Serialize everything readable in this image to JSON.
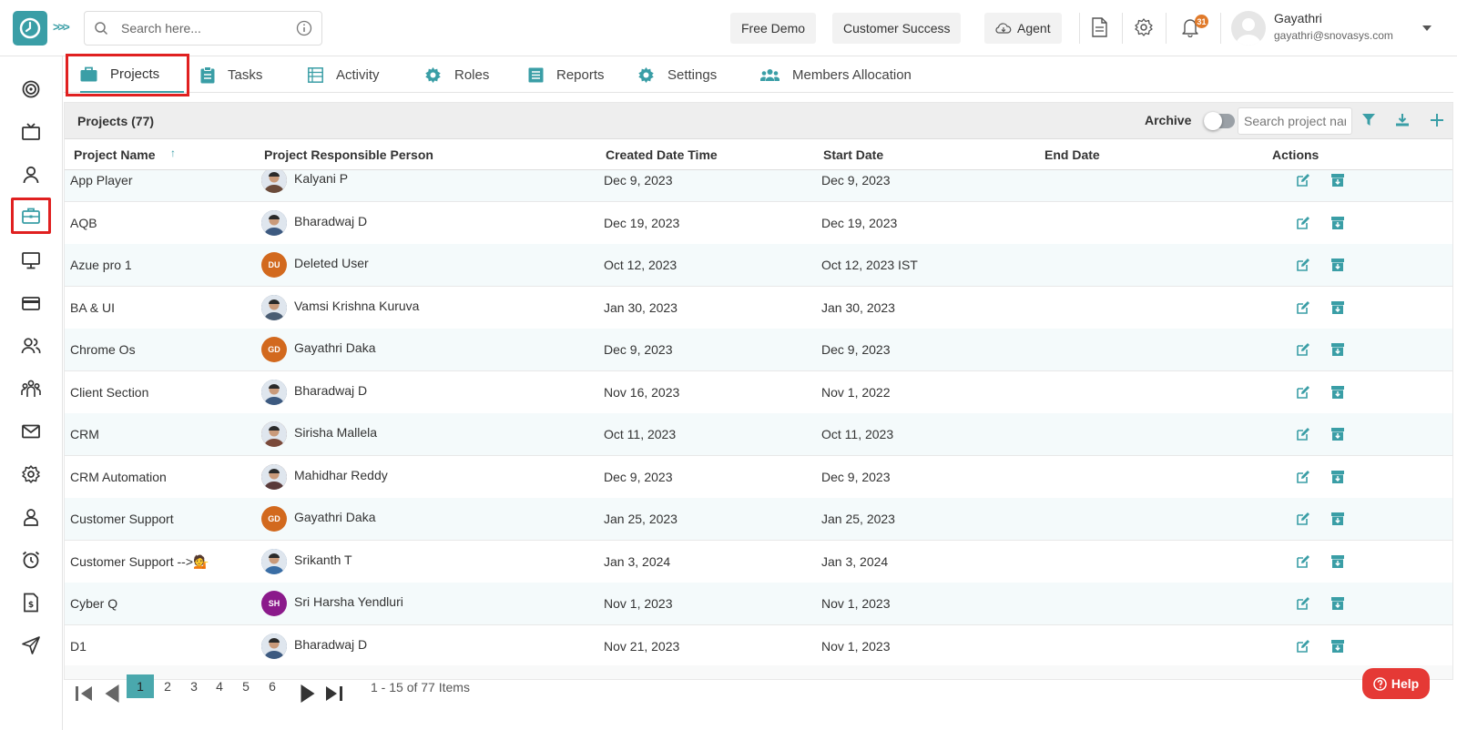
{
  "header": {
    "search_placeholder": "Search here...",
    "free_demo": "Free Demo",
    "customer_success": "Customer Success",
    "agent": "Agent",
    "notification_count": "31",
    "user_name": "Gayathri",
    "user_email": "gayathri@snovasys.com"
  },
  "tabs": [
    {
      "label": "Projects"
    },
    {
      "label": "Tasks"
    },
    {
      "label": "Activity"
    },
    {
      "label": "Roles"
    },
    {
      "label": "Reports"
    },
    {
      "label": "Settings"
    },
    {
      "label": "Members Allocation"
    }
  ],
  "panel": {
    "title": "Projects (77)",
    "archive_label": "Archive",
    "search_placeholder": "Search project name"
  },
  "table": {
    "columns": [
      "Project Name",
      "Project Responsible Person",
      "Created Date Time",
      "Start Date",
      "End Date",
      "Actions"
    ],
    "rows": [
      {
        "name": "App Player",
        "person": "Kalyani P",
        "initials": "",
        "created": "Dec 9, 2023",
        "start": "Dec 9, 2023",
        "end": ""
      },
      {
        "name": "AQB",
        "person": "Bharadwaj D",
        "initials": "",
        "created": "Dec 19, 2023",
        "start": "Dec 19, 2023",
        "end": ""
      },
      {
        "name": "Azue pro 1",
        "person": "Deleted User",
        "initials": "DU",
        "created": "Oct 12, 2023",
        "start": "Oct 12, 2023 IST",
        "end": ""
      },
      {
        "name": "BA & UI",
        "person": "Vamsi Krishna Kuruva",
        "initials": "",
        "created": "Jan 30, 2023",
        "start": "Jan 30, 2023",
        "end": ""
      },
      {
        "name": "Chrome Os",
        "person": "Gayathri Daka",
        "initials": "GD",
        "created": "Dec 9, 2023",
        "start": "Dec 9, 2023",
        "end": ""
      },
      {
        "name": "Client Section",
        "person": "Bharadwaj D",
        "initials": "",
        "created": "Nov 16, 2023",
        "start": "Nov 1, 2022",
        "end": ""
      },
      {
        "name": "CRM",
        "person": "Sirisha Mallela",
        "initials": "",
        "created": "Oct 11, 2023",
        "start": "Oct 11, 2023",
        "end": ""
      },
      {
        "name": "CRM Automation",
        "person": "Mahidhar Reddy",
        "initials": "",
        "created": "Dec 9, 2023",
        "start": "Dec 9, 2023",
        "end": ""
      },
      {
        "name": "Customer Support",
        "person": "Gayathri Daka",
        "initials": "GD",
        "created": "Jan 25, 2023",
        "start": "Jan 25, 2023",
        "end": ""
      },
      {
        "name": "Customer Support -->💁",
        "person": "Srikanth T",
        "initials": "",
        "created": "Jan 3, 2024",
        "start": "Jan 3, 2024",
        "end": ""
      },
      {
        "name": "Cyber Q",
        "person": "Sri Harsha Yendluri",
        "initials": "SH",
        "created": "Nov 1, 2023",
        "start": "Nov 1, 2023",
        "end": ""
      },
      {
        "name": "D1",
        "person": "Bharadwaj D",
        "initials": "",
        "created": "Nov 21, 2023",
        "start": "Nov 1, 2023",
        "end": ""
      }
    ]
  },
  "pagination": {
    "pages": [
      "1",
      "2",
      "3",
      "4",
      "5",
      "6"
    ],
    "current": "1",
    "info": "1 - 15 of 77 Items"
  },
  "help_label": "Help",
  "colors": {
    "accent": "#3a9ea6",
    "highlight": "#e02020",
    "help": "#e53935",
    "avatar_orange": "#d2691e",
    "avatar_purple": "#8b1a8b"
  }
}
